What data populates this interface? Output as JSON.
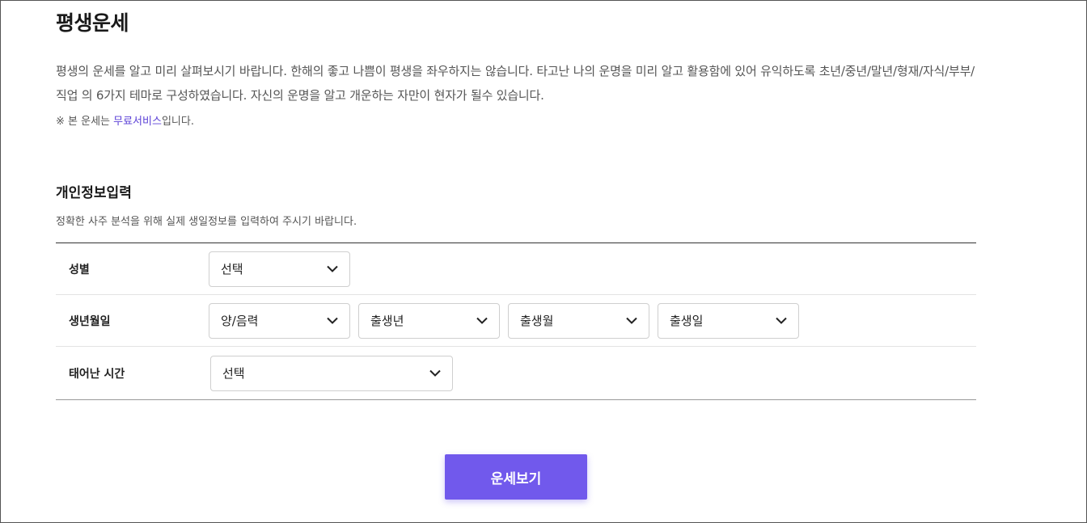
{
  "page": {
    "title": "평생운세",
    "intro": "평생의 운세를 알고 미리 살펴보시기 바랍니다. 한해의 좋고 나쁨이 평생을 좌우하지는 않습니다. 타고난 나의 운명을 미리 알고 활용함에 있어 유익하도록 초년/중년/말년/형재/자식/부부/직업 의 6가지 테마로 구성하였습니다. 자신의 운명을 알고 개운하는 자만이 현자가 될수 있습니다.",
    "notice_prefix": "※ 본 운세는 ",
    "notice_highlight": "무료서비스",
    "notice_suffix": "입니다."
  },
  "form": {
    "title": "개인정보입력",
    "description": "정확한 사주 분석을 위해 실제 생일정보를 입력하여 주시기 바랍니다.",
    "gender": {
      "label": "성별",
      "select": "선택"
    },
    "birthdate": {
      "label": "생년월일",
      "calendar": "양/음력",
      "year": "출생년",
      "month": "출생월",
      "day": "출생일"
    },
    "birthtime": {
      "label": "태어난 시간",
      "select": "선택"
    },
    "submit_label": "운세보기"
  },
  "icons": {
    "dropdown": "chevron-down-icon"
  },
  "colors": {
    "accent": "#7159ec",
    "highlight_text": "#5a3fd6"
  }
}
